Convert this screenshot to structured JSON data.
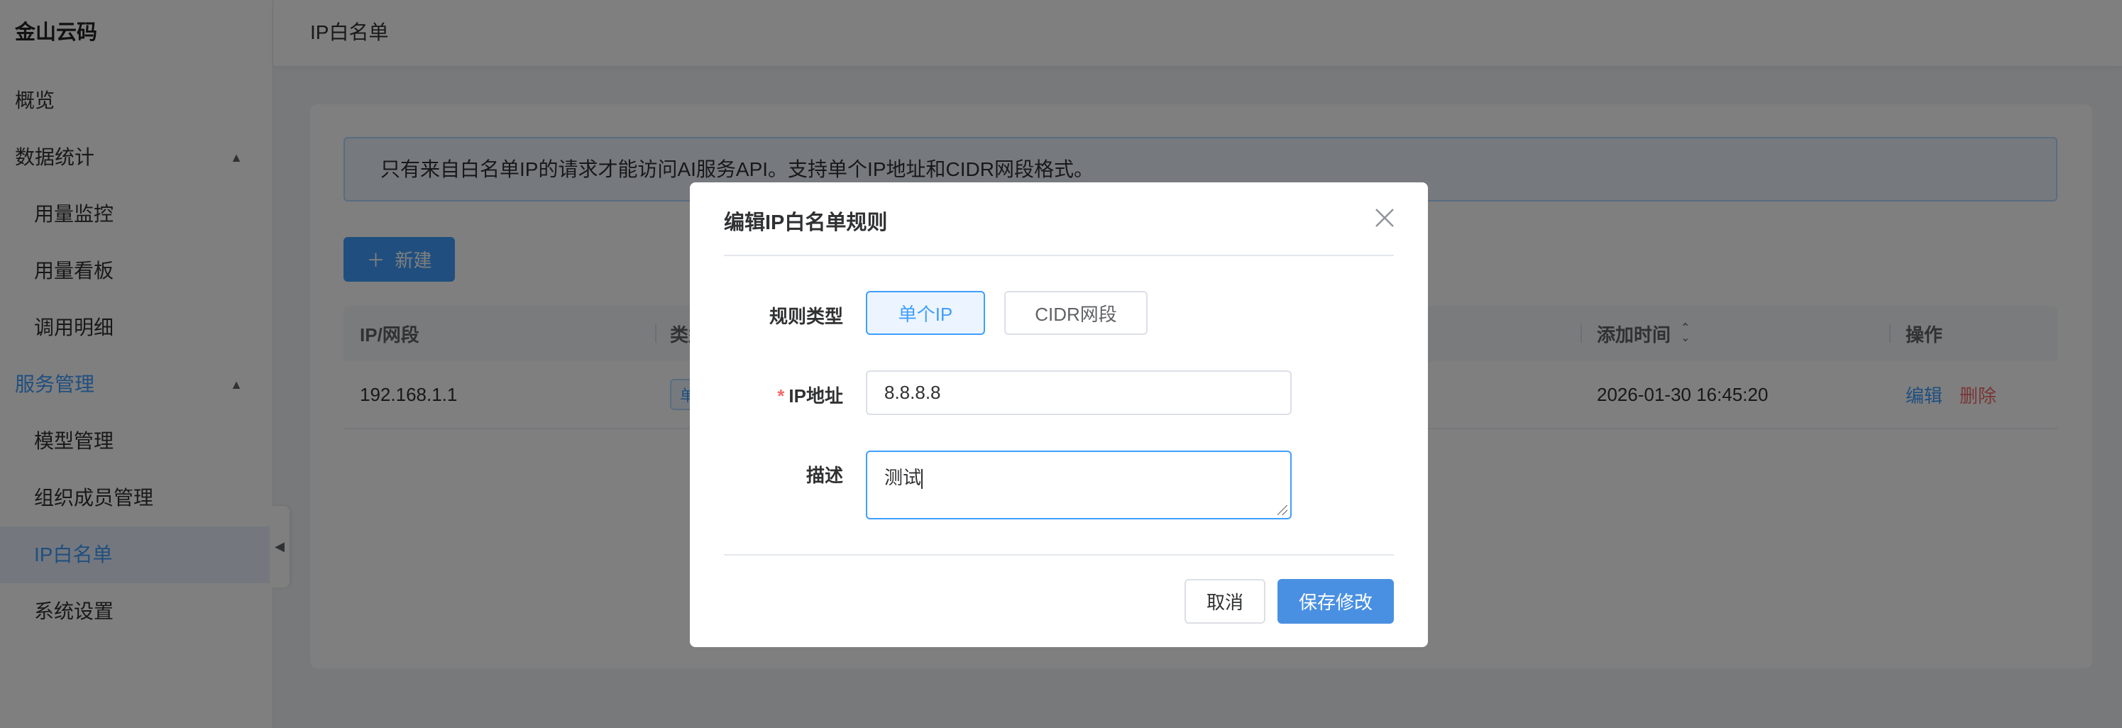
{
  "sidebar": {
    "brand": "金山云码",
    "items": [
      {
        "label": "概览"
      },
      {
        "label": "数据统计"
      },
      {
        "label": "用量监控"
      },
      {
        "label": "用量看板"
      },
      {
        "label": "调用明细"
      },
      {
        "label": "服务管理"
      },
      {
        "label": "模型管理"
      },
      {
        "label": "组织成员管理"
      },
      {
        "label": "IP白名单"
      },
      {
        "label": "系统设置"
      }
    ]
  },
  "header": {
    "title": "IP白名单"
  },
  "main": {
    "alert": "只有来自白名单IP的请求才能访问AI服务API。支持单个IP地址和CIDR网段格式。",
    "new_button": "新建",
    "table": {
      "columns": [
        "IP/网段",
        "类型",
        "添加时间",
        "操作"
      ],
      "rows": [
        {
          "ip": "192.168.1.1",
          "type": "单个IP",
          "added": "2026-01-30 16:45:20",
          "edit": "编辑",
          "delete": "删除"
        }
      ]
    }
  },
  "modal": {
    "title": "编辑IP白名单规则",
    "rule_type_label": "规则类型",
    "rule_types": [
      "单个IP",
      "CIDR网段"
    ],
    "selected_rule_type": "单个IP",
    "ip_label": "IP地址",
    "ip_value": "8.8.8.8",
    "desc_label": "描述",
    "desc_value": "测试",
    "cancel": "取消",
    "save": "保存修改"
  },
  "colors": {
    "primary": "#409eff",
    "danger": "#f56c6c",
    "save": "#4a90e2"
  }
}
